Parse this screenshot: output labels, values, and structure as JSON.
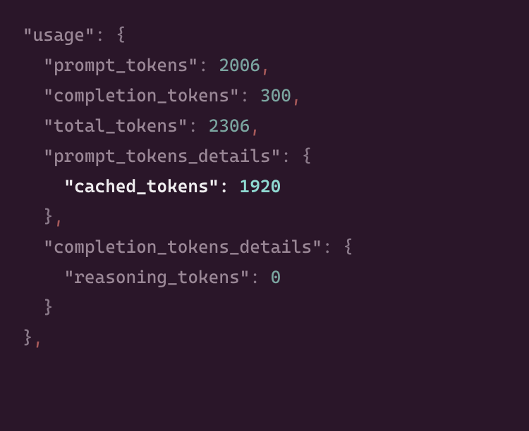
{
  "code": {
    "keys": {
      "usage": "\"usage\"",
      "prompt_tokens": "\"prompt_tokens\"",
      "completion_tokens": "\"completion_tokens\"",
      "total_tokens": "\"total_tokens\"",
      "prompt_tokens_details": "\"prompt_tokens_details\"",
      "cached_tokens": "\"cached_tokens\"",
      "completion_tokens_details": "\"completion_tokens_details\"",
      "reasoning_tokens": "\"reasoning_tokens\""
    },
    "values": {
      "prompt_tokens": "2006",
      "completion_tokens": "300",
      "total_tokens": "2306",
      "cached_tokens": "1920",
      "reasoning_tokens": "0"
    },
    "punct": {
      "colon_space": ": ",
      "open_brace": "{",
      "close_brace": "}",
      "comma": ","
    }
  }
}
